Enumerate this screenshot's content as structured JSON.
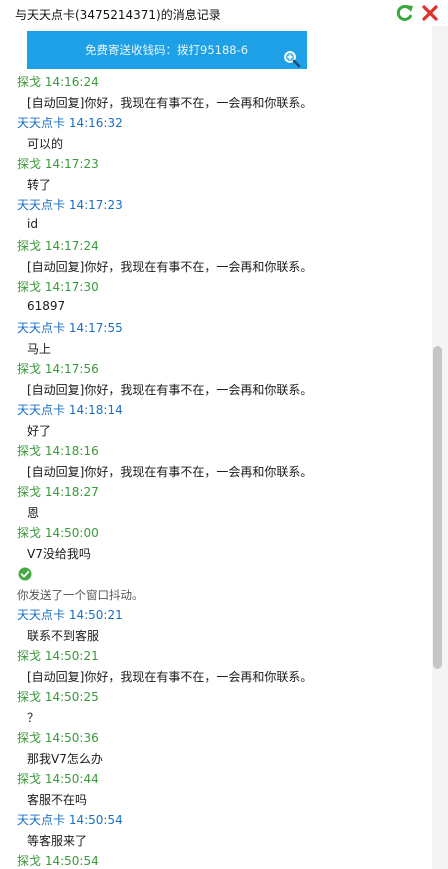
{
  "window": {
    "title": "与天天点卡(3475214371)的消息记录"
  },
  "banner": {
    "text": "免费寄送收钱码：拨打95188-6"
  },
  "messages": [
    {
      "sender": "探戈",
      "time": "14:16:24",
      "text": "[自动回复]你好，我现在有事不在，一会再和你联系。",
      "side": "green"
    },
    {
      "sender": "天天点卡",
      "time": "14:16:32",
      "text": "可以的",
      "side": "blue"
    },
    {
      "sender": "探戈",
      "time": "14:17:23",
      "text": "转了",
      "side": "green"
    },
    {
      "sender": "天天点卡",
      "time": "14:17:23",
      "text": "id",
      "side": "blue"
    },
    {
      "sender": "探戈",
      "time": "14:17:24",
      "text": "[自动回复]你好，我现在有事不在，一会再和你联系。",
      "side": "green"
    },
    {
      "sender": "探戈",
      "time": "14:17:30",
      "text": "61897",
      "side": "green"
    },
    {
      "sender": "天天点卡",
      "time": "14:17:55",
      "text": "马上",
      "side": "blue"
    },
    {
      "sender": "探戈",
      "time": "14:17:56",
      "text": "[自动回复]你好，我现在有事不在，一会再和你联系。",
      "side": "green"
    },
    {
      "sender": "天天点卡",
      "time": "14:18:14",
      "text": "好了",
      "side": "blue"
    },
    {
      "sender": "探戈",
      "time": "14:18:16",
      "text": "[自动回复]你好，我现在有事不在，一会再和你联系。",
      "side": "green"
    },
    {
      "sender": "探戈",
      "time": "14:18:27",
      "text": "恩",
      "side": "green"
    },
    {
      "sender": "探戈",
      "time": "14:50:00",
      "text": "V7没给我吗",
      "side": "green"
    }
  ],
  "shake_note": "你发送了一个窗口抖动。",
  "messages_after": [
    {
      "sender": "天天点卡",
      "time": "14:50:21",
      "text": "联系不到客服",
      "side": "blue"
    },
    {
      "sender": "探戈",
      "time": "14:50:21",
      "text": "[自动回复]你好，我现在有事不在，一会再和你联系。",
      "side": "green"
    },
    {
      "sender": "探戈",
      "time": "14:50:25",
      "text": "？",
      "side": "green"
    },
    {
      "sender": "探戈",
      "time": "14:50:36",
      "text": "那我V7怎么办",
      "side": "green"
    },
    {
      "sender": "探戈",
      "time": "14:50:44",
      "text": "客服不在吗",
      "side": "green"
    },
    {
      "sender": "天天点卡",
      "time": "14:50:54",
      "text": "等客服来了",
      "side": "blue"
    },
    {
      "sender": "探戈",
      "time": "14:50:54",
      "text": "",
      "side": "green"
    }
  ],
  "icons": {
    "refresh": "refresh-icon",
    "close": "close-icon",
    "zoom": "zoom-in-icon",
    "check": "check-circle-icon"
  },
  "colors": {
    "self": "#3a9a3a",
    "other": "#1a6fc4",
    "banner": "#1ea0e6"
  }
}
